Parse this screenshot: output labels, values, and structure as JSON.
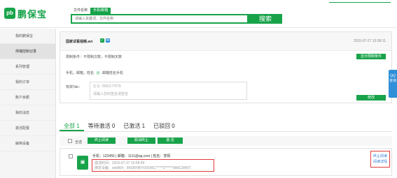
{
  "header": {
    "logo_mark": "pb",
    "logo_text": "鹏保宝",
    "search_tabs": [
      {
        "label": "文件名称"
      },
      {
        "label": "手机/邮箱"
      }
    ],
    "search_placeholder": "请输入关键词、文件名称",
    "search_button": "搜索"
  },
  "sidebar": {
    "items": [
      {
        "label": "我的鹏保宝"
      },
      {
        "label": "停播控制记录"
      },
      {
        "label": "系列管理"
      },
      {
        "label": "我的订单"
      },
      {
        "label": "账户余额"
      },
      {
        "label": "我的消息"
      },
      {
        "label": "激活配置"
      },
      {
        "label": "解绑设备"
      }
    ]
  },
  "file_card": {
    "file_name": "国家试看视频.avi",
    "created": "2015-07-27 15:58:11",
    "limit_text": "限制条件：不限制次数，不限制天数",
    "limit_button": "显示限制条件",
    "fields_text": "手机，邮箱，姓名",
    "fields_extra": "邮箱姓名手机",
    "signature_label": "有效Tab：",
    "qq_label": "Q Q: 2560177078",
    "signature_placeholder": "请输入您的签名请签名",
    "edit_button": "修改"
  },
  "qq_float": {
    "label": "QQ咨询"
  },
  "status_tabs": [
    {
      "label": "全部 1"
    },
    {
      "label": "等待激活 0"
    },
    {
      "label": "已激活 1"
    },
    {
      "label": "已驳回 0"
    }
  ],
  "toolbar": {
    "select_all": "全选",
    "buttons": [
      {
        "label": "终止阅读"
      },
      {
        "label": "取消终止"
      },
      {
        "label": "激 活"
      }
    ]
  },
  "record": {
    "info": "手机：123456  |  邮箱：1111@qq.com  |  姓名：李阳",
    "activated": "激活时间：2015-07-27 15:58:49",
    "device": "绑定设备：win864：8FEBF8FF00036C*****3******8A6C58WT",
    "actions": [
      {
        "label": "终止阅读"
      },
      {
        "label": "阅读详情"
      }
    ]
  },
  "colors": {
    "accent": "#18a34a",
    "highlight": "#e23a3a",
    "link": "#2f7fd8"
  }
}
